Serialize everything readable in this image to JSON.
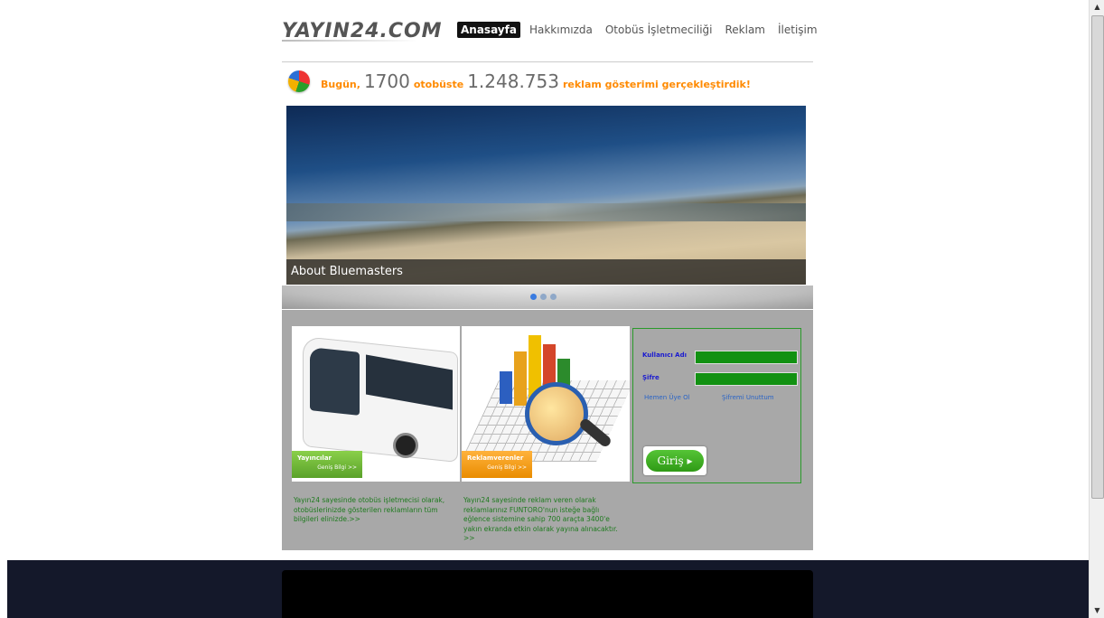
{
  "header": {
    "logo": "YAYIN24.COM",
    "nav": [
      {
        "label": "Anasayfa",
        "active": true
      },
      {
        "label": "Hakkımızda",
        "active": false
      },
      {
        "label": "Otobüs İşletmeciliği",
        "active": false
      },
      {
        "label": "Reklam",
        "active": false
      },
      {
        "label": "İletişim",
        "active": false
      }
    ]
  },
  "counter": {
    "prefix": "Bugün,",
    "buses": "1700",
    "buses_label": "otobüste",
    "impressions": "1.248.753",
    "suffix": "reklam gösterimi gerçekleştirdik!"
  },
  "slider": {
    "caption": "About Bluemasters",
    "slide_count": 3,
    "active_slide": 1
  },
  "cards": {
    "publishers": {
      "button": "Yayıncılar",
      "more": "Geniş Bilgi >>"
    },
    "advertisers": {
      "button": "Reklamverenler",
      "more": "Geniş Bilgi >>"
    }
  },
  "login": {
    "username_label": "Kullanıcı Adı",
    "password_label": "Şifre",
    "signup_link": "Hemen Üye Ol",
    "forgot_link": "Şifremi Unuttum",
    "submit": "Giriş ▸"
  },
  "descriptions": {
    "publishers": "Yayın24 sayesinde otobüs işletmecisi olarak, otobüslerinizde gösterilen reklamların tüm bilgileri elinizde.>>",
    "advertisers": "Yayın24 sayesinde reklam veren olarak reklamlarınız FUNTORO'nun isteğe bağlı eğlence sistemine sahip 700 araçta 3400'e yakın ekranda etkin olarak yayına alınacaktır. >>"
  },
  "colors": {
    "accent_orange": "#ff8a00",
    "nav_active_bg": "#111111",
    "panel_bg": "#a8a8a8",
    "field_green": "#129112",
    "desc_green": "#1e7a1e",
    "footer_bg": "#14182a"
  }
}
